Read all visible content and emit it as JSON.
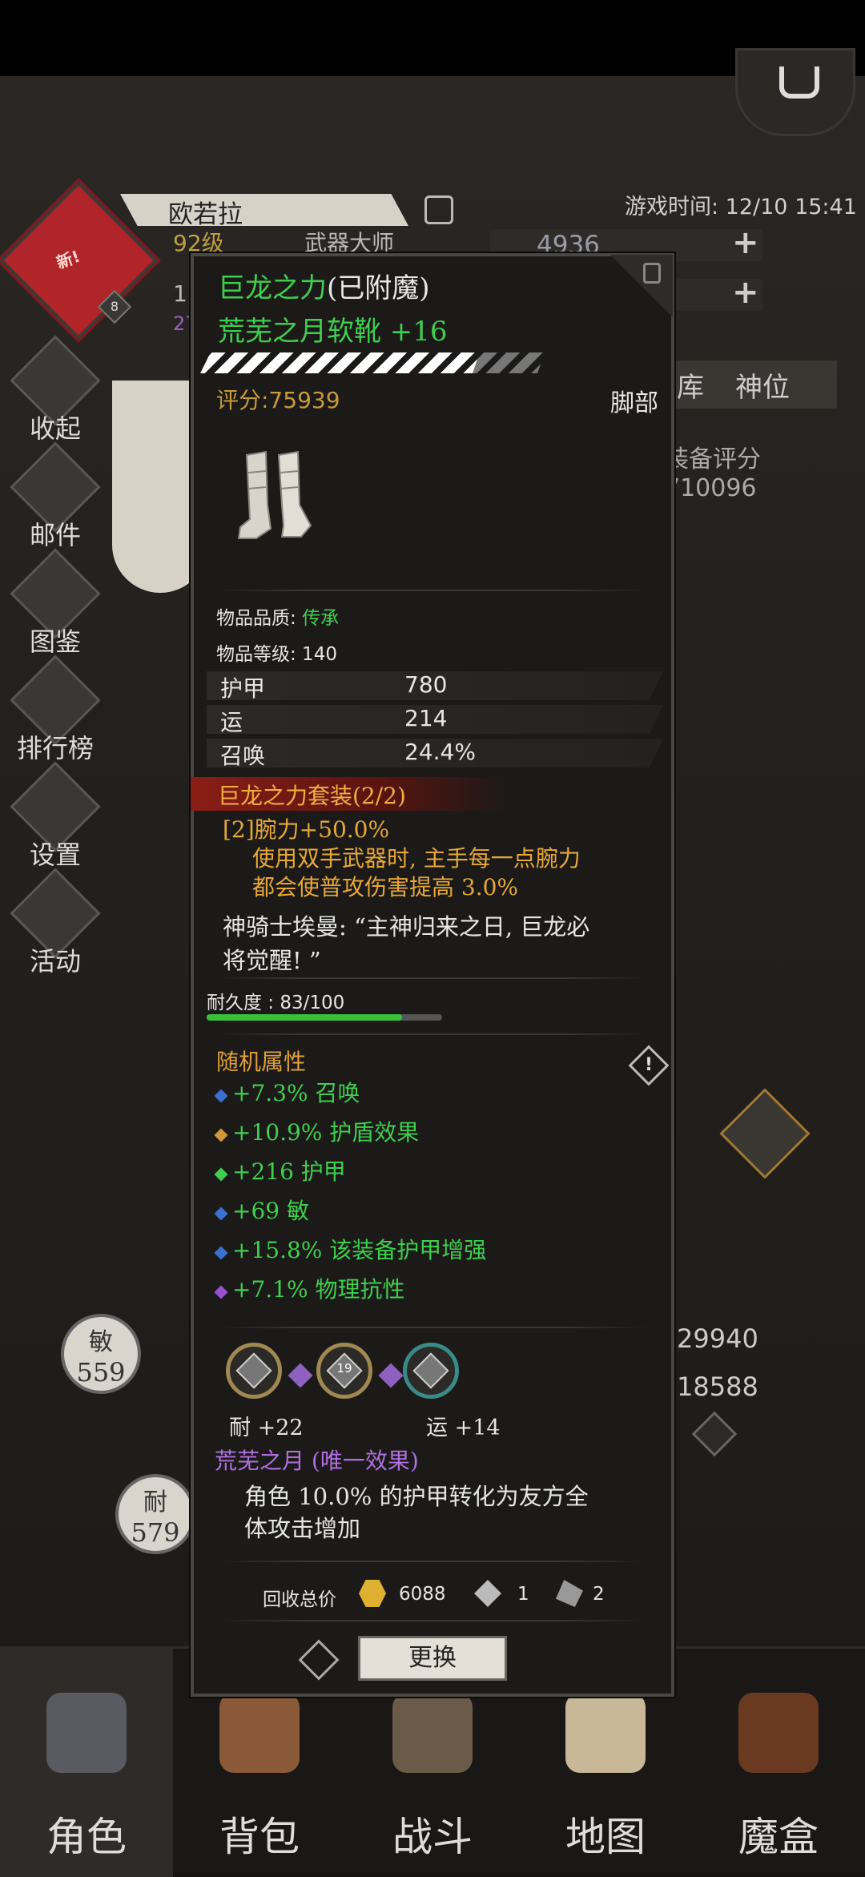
{
  "hud": {
    "game_time": "游戏时间: 12/10 15:41",
    "player_name": "欧若拉",
    "level": "92级",
    "title": "武器大师",
    "avatar_badge": "新!",
    "avatar_level": "8",
    "gem_count": "4936",
    "stub_1": "1",
    "stub_27": "27"
  },
  "side_menu": [
    "收起",
    "邮件",
    "图鉴",
    "排行榜",
    "设置",
    "活动"
  ],
  "right_panel": {
    "tab_partial": "库",
    "tab_god": "神位",
    "score_label": "装备评分",
    "score_value": "710096",
    "stat1": "29940",
    "stat2": "18588"
  },
  "stat_circles": {
    "agi_label": "敏",
    "agi_value": "559",
    "end_label": "耐",
    "end_value": "579"
  },
  "tooltip": {
    "set_name": "巨龙之力",
    "enchant_tag": "(已附魔)",
    "item_name": "荒芜之月软靴 +16",
    "score": "评分:75939",
    "slot": "脚部",
    "quality_label": "物品品质: ",
    "quality_value": "传承",
    "item_level": "物品等级: 140",
    "stats": [
      {
        "name": "护甲",
        "value": "780"
      },
      {
        "name": "运",
        "value": "214"
      },
      {
        "name": "召唤",
        "value": "24.4%"
      }
    ],
    "set_title": "巨龙之力套装(2/2)",
    "set_bonus_1": "[2]腕力+50.0%",
    "set_bonus_2": "使用双手武器时, 主手每一点腕力",
    "set_bonus_3": "都会使普攻伤害提高 3.0%",
    "lore_1": "神骑士埃曼: “主神归来之日, 巨龙必",
    "lore_2": "将觉醒! ”",
    "durability_label": "耐久度 : 83/100",
    "durability_fraction": 0.83,
    "random_title": "随机属性",
    "random_attrs": [
      {
        "text": "+7.3% 召唤",
        "dot": "#3a70d0"
      },
      {
        "text": "+10.9% 护盾效果",
        "dot": "#d09838"
      },
      {
        "text": "+216 护甲",
        "dot": "#3fcf4f"
      },
      {
        "text": "+69 敏",
        "dot": "#3a70d0"
      },
      {
        "text": "+15.8% 该装备护甲增强",
        "dot": "#3a70d0"
      },
      {
        "text": "+7.1% 物理抗性",
        "dot": "#9a50d0"
      }
    ],
    "gem_socket_label": "19",
    "gem_bonus_left": "耐 +22",
    "gem_bonus_right": "运 +14",
    "unique_title": "荒芜之月 (唯一效果)",
    "unique_desc_1": "角色 10.0% 的护甲转化为友方全",
    "unique_desc_2": "体攻击增加",
    "price_label": "回收总价",
    "price_gold": "6088",
    "price_mat1": "1",
    "price_mat2": "2",
    "swap_label": "更换"
  },
  "bottom_nav": [
    "角色",
    "背包",
    "战斗",
    "地图",
    "魔盒"
  ]
}
